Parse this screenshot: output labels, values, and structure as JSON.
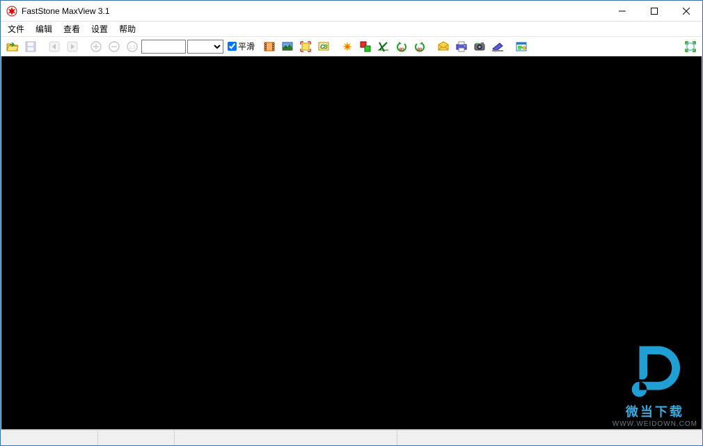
{
  "window": {
    "title": "FastStone MaxView 3.1"
  },
  "menu": {
    "file": "文件",
    "edit": "编辑",
    "view": "查看",
    "settings": "设置",
    "help": "帮助"
  },
  "toolbar": {
    "zoom_input_value": "",
    "zoom_select_value": "",
    "smooth_label": "平滑",
    "smooth_checked": true,
    "icons": {
      "open": "open-folder-icon",
      "save": "save-icon",
      "prev": "prev-icon",
      "next": "next-icon",
      "zoom_in": "zoom-in-icon",
      "zoom_out": "zoom-out-icon",
      "zoom_fit": "zoom-fit-icon",
      "slideshow": "slideshow-icon",
      "wallpaper": "wallpaper-icon",
      "resize": "resize-canvas-icon",
      "draw": "text-board-icon",
      "color_effects": "color-effects-icon",
      "compare": "compare-icon",
      "crop": "crop-icon",
      "rotate_left": "rotate-left-icon",
      "rotate_right": "rotate-right-icon",
      "email": "email-icon",
      "print": "print-icon",
      "screenshot": "screenshot-icon",
      "scan": "scan-icon",
      "settings": "settings-panel-icon",
      "fullscreen": "fullscreen-icon"
    }
  },
  "status": {
    "cell1": "",
    "cell2": "",
    "cell3": "",
    "cell4": ""
  },
  "watermark": {
    "cn_text": "微当下载",
    "url_text": "WWW.WEIDOWN.COM"
  },
  "colors": {
    "titlebar_bg": "#ffffff",
    "viewport_bg": "#000000",
    "accent": "#3ea8d8"
  }
}
